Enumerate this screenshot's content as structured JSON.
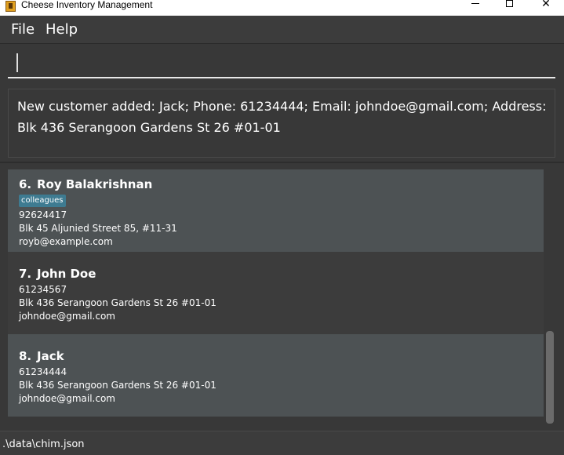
{
  "window": {
    "title": "Cheese Inventory Management",
    "minimize_label": "—",
    "close_label": "✕"
  },
  "menu": {
    "items": [
      {
        "label": "File"
      },
      {
        "label": "Help"
      }
    ]
  },
  "command_box": {
    "value": "",
    "placeholder": ""
  },
  "result_display": {
    "text": "New customer added: Jack; Phone: 61234444; Email: johndoe@gmail.com; Address: Blk 436 Serangoon Gardens St 26 #01-01"
  },
  "customer_list": {
    "cards": [
      {
        "index": "6.",
        "name": "Roy Balakrishnan",
        "tag": "colleagues",
        "phone": "92624417",
        "address": "Blk 45 Aljunied Street 85, #11-31",
        "email": "royb@example.com"
      },
      {
        "index": "7.",
        "name": "John Doe",
        "phone": "61234567",
        "address": "Blk 436 Serangoon Gardens St 26 #01-01",
        "email": "johndoe@gmail.com"
      },
      {
        "index": "8.",
        "name": "Jack",
        "phone": "61234444",
        "address": "Blk 436 Serangoon Gardens St 26 #01-01",
        "email": "johndoe@gmail.com"
      }
    ]
  },
  "status_bar": {
    "file_path": ".\\data\\chim.json"
  },
  "colors": {
    "background": "#383838",
    "card_odd": "#4d5254",
    "card_even": "#3c3c3c",
    "tag": "#3e7b91",
    "text": "#ffffff"
  },
  "icons": {
    "app": "cheese-app-icon",
    "minimize": "minimize-icon",
    "maximize": "maximize-icon",
    "close": "close-icon"
  }
}
